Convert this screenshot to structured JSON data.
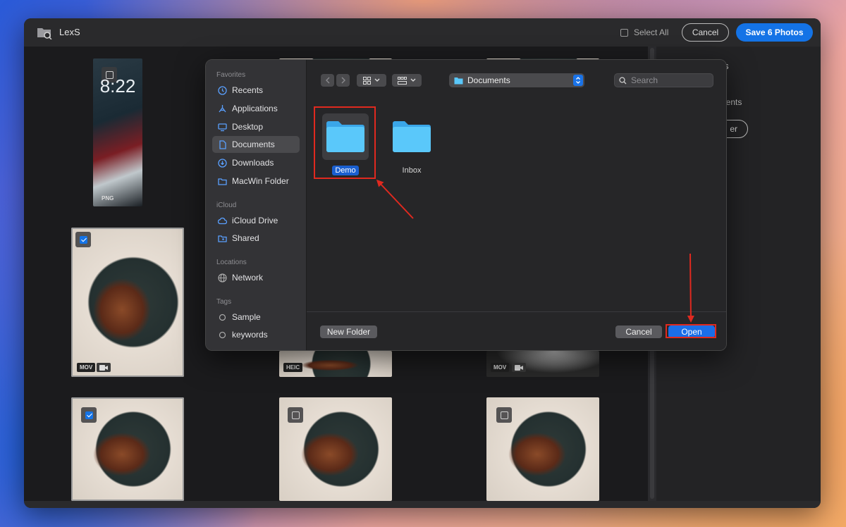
{
  "app": {
    "name": "LexS"
  },
  "toolbar": {
    "select_all_label": "Select All",
    "cancel_label": "Cancel",
    "save_label": "Save 6 Photos"
  },
  "right_panel": {
    "text1": "s",
    "text2": "uments",
    "button_label": "er"
  },
  "grid": {
    "items": [
      {
        "badge": "PNG",
        "checked": false,
        "time": "8:22"
      },
      {
        "badge": "MOV",
        "checked": true
      },
      {
        "badge": "HEIC"
      },
      {
        "badge": "MOV"
      },
      {
        "checked": true
      },
      {
        "checked": false
      },
      {
        "checked": false
      }
    ]
  },
  "dialog": {
    "sidebar": {
      "favorites_label": "Favorites",
      "favorites": [
        {
          "label": "Recents",
          "icon": "clock-icon"
        },
        {
          "label": "Applications",
          "icon": "applications-icon"
        },
        {
          "label": "Desktop",
          "icon": "desktop-icon"
        },
        {
          "label": "Documents",
          "icon": "document-icon",
          "active": true
        },
        {
          "label": "Downloads",
          "icon": "download-icon"
        },
        {
          "label": "MacWin Folder",
          "icon": "folder-icon"
        }
      ],
      "icloud_label": "iCloud",
      "icloud": [
        {
          "label": "iCloud Drive",
          "icon": "cloud-icon"
        },
        {
          "label": "Shared",
          "icon": "shared-folder-icon"
        }
      ],
      "locations_label": "Locations",
      "locations": [
        {
          "label": "Network",
          "icon": "globe-icon"
        }
      ],
      "tags_label": "Tags",
      "tags": [
        {
          "label": "Sample"
        },
        {
          "label": "keywords"
        }
      ]
    },
    "location": "Documents",
    "search_placeholder": "Search",
    "files": [
      {
        "label": "Demo",
        "selected": true
      },
      {
        "label": "Inbox",
        "selected": false
      }
    ],
    "new_folder_label": "New Folder",
    "cancel_label": "Cancel",
    "open_label": "Open"
  },
  "colors": {
    "accent": "#1473e6",
    "annotation": "#e0291f",
    "folder": "#5ac8fa"
  }
}
